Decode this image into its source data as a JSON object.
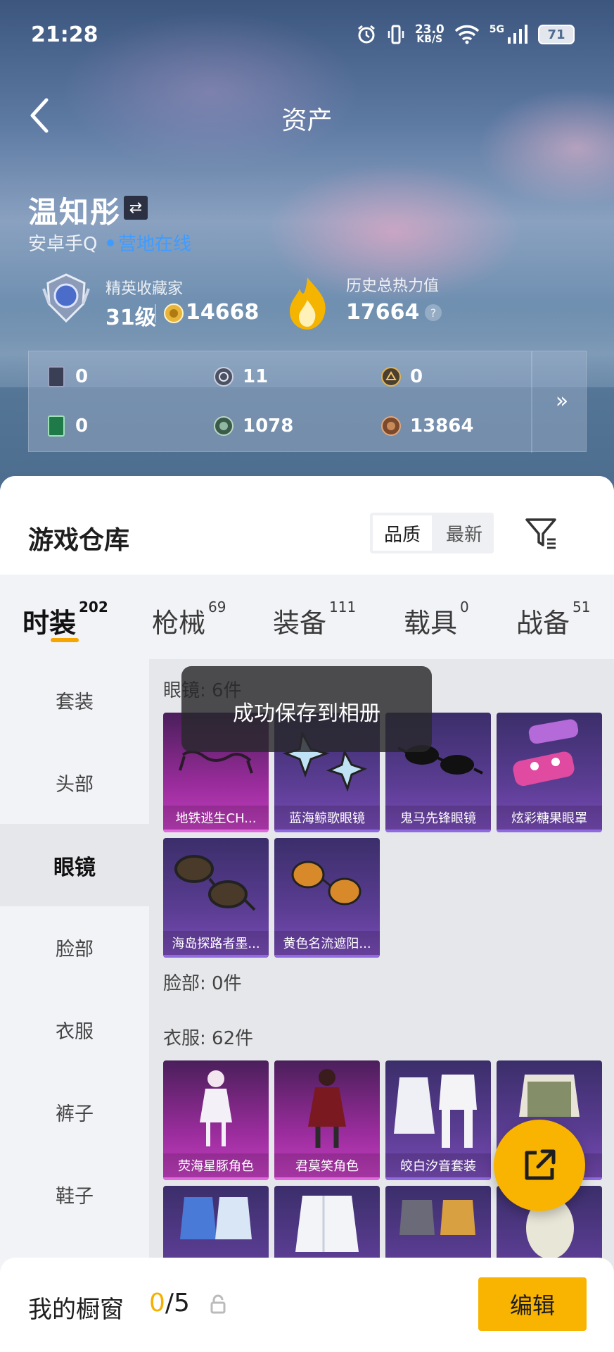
{
  "status_bar": {
    "time": "21:28",
    "net_speed": "23.0",
    "net_unit": "KB/S",
    "network": "5G",
    "battery": "71"
  },
  "nav": {
    "title": "资产"
  },
  "profile": {
    "name": "温知彤",
    "platform": "安卓手Q",
    "status": "营地在线",
    "collector_label": "精英收藏家",
    "collector_level": "31级",
    "collector_points": "14668",
    "heat_label": "历史总热力值",
    "heat_value": "17664",
    "help": "?"
  },
  "currencies": [
    {
      "icon": "card-black-icon",
      "value": "0"
    },
    {
      "icon": "coin-silver-icon",
      "value": "11"
    },
    {
      "icon": "coin-gold-icon",
      "value": "0"
    },
    {
      "icon": "card-green-icon",
      "value": "0"
    },
    {
      "icon": "coin-green-icon",
      "value": "1078"
    },
    {
      "icon": "coin-bronze-icon",
      "value": "13864"
    }
  ],
  "currency_more": "»",
  "warehouse": {
    "title": "游戏仓库",
    "sort_options": [
      "品质",
      "最新"
    ],
    "sort_selected": "品质",
    "tabs": [
      {
        "label": "时装",
        "count": "202"
      },
      {
        "label": "枪械",
        "count": "69"
      },
      {
        "label": "装备",
        "count": "111"
      },
      {
        "label": "载具",
        "count": "0"
      },
      {
        "label": "战备",
        "count": "51"
      }
    ],
    "sidebar": [
      "套装",
      "头部",
      "眼镜",
      "脸部",
      "衣服",
      "裤子",
      "鞋子"
    ],
    "sidebar_selected": "眼镜",
    "sections": {
      "glasses": {
        "title": "眼镜: 6件",
        "items": [
          {
            "name": "地铁逃生CH...",
            "rarity": "pink"
          },
          {
            "name": "蓝海鲸歌眼镜",
            "rarity": "purple"
          },
          {
            "name": "鬼马先锋眼镜",
            "rarity": "purple"
          },
          {
            "name": "炫彩糖果眼罩",
            "rarity": "purple"
          },
          {
            "name": "海岛探路者墨...",
            "rarity": "purple"
          },
          {
            "name": "黄色名流遮阳...",
            "rarity": "purple"
          }
        ]
      },
      "face": {
        "title": "脸部: 0件"
      },
      "clothes": {
        "title": "衣服: 62件",
        "items": [
          {
            "name": "荧海星豚角色",
            "rarity": "pink"
          },
          {
            "name": "君莫笑角色",
            "rarity": "pink"
          },
          {
            "name": "皎白汐音套装",
            "rarity": "purple"
          },
          {
            "name": "",
            "rarity": "purple"
          },
          {
            "name": "",
            "rarity": "purple"
          },
          {
            "name": "",
            "rarity": "purple"
          },
          {
            "name": "",
            "rarity": "purple"
          },
          {
            "name": "",
            "rarity": "purple"
          }
        ]
      }
    }
  },
  "toast": "成功保存到相册",
  "showcase": {
    "label": "我的橱窗",
    "current": "0",
    "total": "/5",
    "edit": "编辑"
  },
  "colors": {
    "accent": "#f8b400",
    "online": "#3f9cff",
    "card_purple": "#5b3d93",
    "card_pink": "#9a2c9c"
  }
}
